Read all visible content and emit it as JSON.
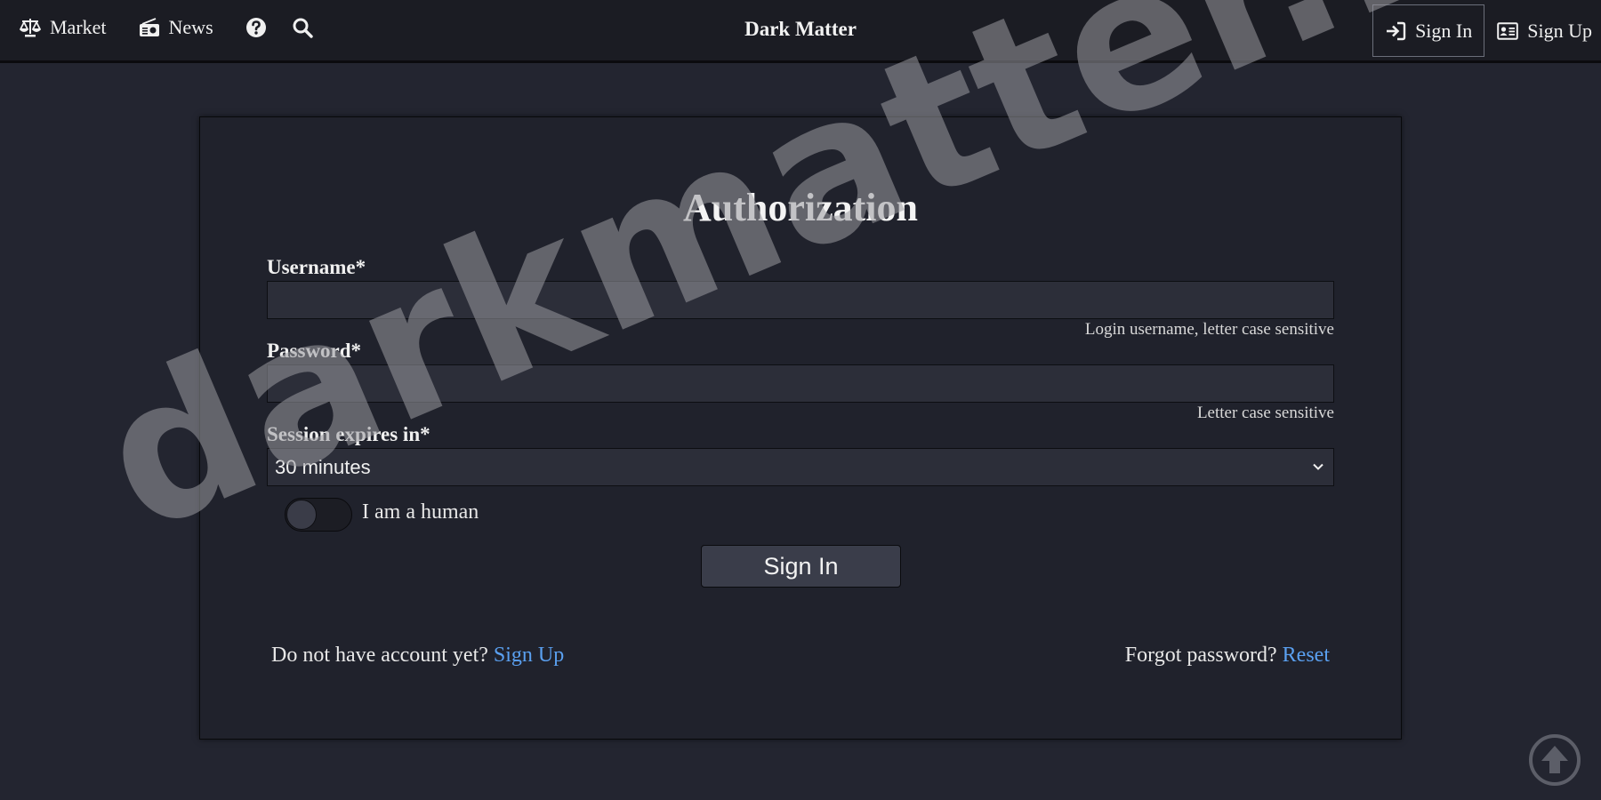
{
  "nav": {
    "market_label": "Market",
    "news_label": "News",
    "brand": "Dark Matter",
    "signin_label": "Sign In",
    "signup_label": "Sign Up",
    "icons": [
      "balance-scale-icon",
      "radio-icon",
      "question-circle-icon",
      "search-icon",
      "sign-in-icon",
      "id-card-icon"
    ]
  },
  "form": {
    "title": "Authorization",
    "username_label": "Username*",
    "username_value": "",
    "username_hint": "Login username, letter case sensitive",
    "password_label": "Password*",
    "password_value": "",
    "password_hint": "Letter case sensitive",
    "session_label": "Session expires in*",
    "session_value": "30 minutes",
    "human_label": "I am a human",
    "human_checked": false,
    "submit_label": "Sign In"
  },
  "footer": {
    "no_account_text": "Do not have account yet?",
    "signup_link": "Sign Up",
    "forgot_text": "Forgot password?",
    "reset_link": "Reset"
  },
  "watermark": "darkmatter.life",
  "colors": {
    "background": "#232530",
    "topbar": "#1b1c23",
    "card": "#20222c",
    "link": "#5aa0f0"
  }
}
